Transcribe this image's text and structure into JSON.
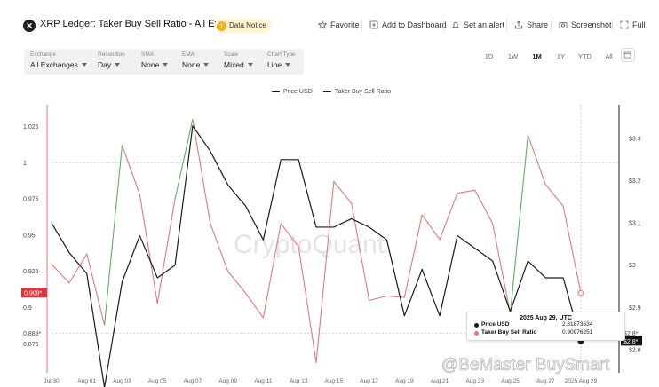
{
  "header": {
    "logo_glyph": "✕",
    "title": "XRP Ledger: Taker Buy Sell Ratio - All Exchanges",
    "notice_badge": "!",
    "notice_label": "Data Notice",
    "actions": {
      "favorite": "Favorite",
      "add_dashboard": "Add to Dashboard",
      "alert": "Set an alert",
      "share": "Share",
      "screenshot": "Screenshot",
      "full": "Full"
    }
  },
  "controls": [
    {
      "label": "Exchange",
      "value": "All Exchanges"
    },
    {
      "label": "Resolution",
      "value": "Day"
    },
    {
      "label": "SMA",
      "value": "None"
    },
    {
      "label": "EMA",
      "value": "None"
    },
    {
      "label": "Scale",
      "value": "Mixed"
    },
    {
      "label": "Chart Type",
      "value": "Line"
    }
  ],
  "ranges": {
    "options": [
      "1D",
      "1W",
      "1M",
      "1Y",
      "YTD",
      "All"
    ],
    "active": "1M"
  },
  "legend": {
    "price": "Price USD",
    "ratio": "Taker Buy Sell Ratio"
  },
  "watermark": {
    "main": "CryptoQuant",
    "credit": "@BeMaster BuySmart"
  },
  "tooltip": {
    "title": "2025 Aug 29, UTC",
    "price_label": "Price USD",
    "price_value": "2.81873534",
    "ratio_label": "Taker Buy Sell Ratio",
    "ratio_value": "0.90976251"
  },
  "chart_data": {
    "type": "line",
    "x_ticks": [
      "Jul 30",
      "Aug 01",
      "Aug 03",
      "Aug 05",
      "Aug 07",
      "Aug 09",
      "Aug 11",
      "Aug 13",
      "Aug 15",
      "Aug 17",
      "Aug 19",
      "Aug 21",
      "Aug 23",
      "Aug 25",
      "Aug 27",
      "2025 Aug 29"
    ],
    "left_axis": {
      "ticks": [
        1.025,
        1,
        0.975,
        0.95,
        0.925,
        0.9,
        0.875
      ],
      "ylim": [
        0.855,
        1.04
      ]
    },
    "right_axis": {
      "ticks": [
        "$3.3",
        "$3.2",
        "$3.1",
        "$3",
        "$2.9",
        "$2.8"
      ],
      "ylim": [
        2.745,
        3.38
      ]
    },
    "left_marker": "0.909*",
    "left_ref": "0.889*",
    "right_ref": "$2.8*",
    "right_marker": "$2.8*",
    "x": [
      "Jul 30",
      "Jul 31",
      "Aug 01",
      "Aug 02",
      "Aug 03",
      "Aug 04",
      "Aug 05",
      "Aug 06",
      "Aug 07",
      "Aug 08",
      "Aug 09",
      "Aug 10",
      "Aug 11",
      "Aug 12",
      "Aug 13",
      "Aug 14",
      "Aug 15",
      "Aug 16",
      "Aug 17",
      "Aug 18",
      "Aug 19",
      "Aug 20",
      "Aug 21",
      "Aug 22",
      "Aug 23",
      "Aug 24",
      "Aug 25",
      "Aug 26",
      "Aug 27",
      "Aug 28",
      "Aug 29"
    ],
    "series": [
      {
        "name": "Price USD",
        "axis": "right",
        "color": "#1a1a1a",
        "values": [
          3.1,
          3.03,
          2.98,
          2.71,
          2.96,
          3.07,
          2.97,
          3.0,
          3.33,
          3.27,
          3.19,
          3.14,
          3.06,
          3.25,
          3.25,
          3.09,
          3.09,
          3.11,
          3.09,
          3.06,
          2.88,
          2.99,
          2.88,
          3.07,
          3.04,
          3.01,
          2.89,
          3.01,
          2.97,
          2.97,
          2.82
        ]
      },
      {
        "name": "Taker Buy Sell Ratio",
        "axis": "left",
        "color": "#e07a7a",
        "up_color": "#5fae5f",
        "values": [
          0.93,
          0.917,
          0.937,
          0.888,
          1.012,
          0.978,
          0.903,
          0.975,
          1.03,
          0.958,
          0.925,
          0.91,
          0.893,
          0.958,
          0.942,
          0.862,
          0.987,
          0.972,
          0.905,
          0.908,
          0.907,
          0.964,
          0.947,
          0.979,
          0.981,
          0.958,
          0.896,
          1.019,
          0.985,
          0.97,
          0.91
        ]
      }
    ]
  }
}
